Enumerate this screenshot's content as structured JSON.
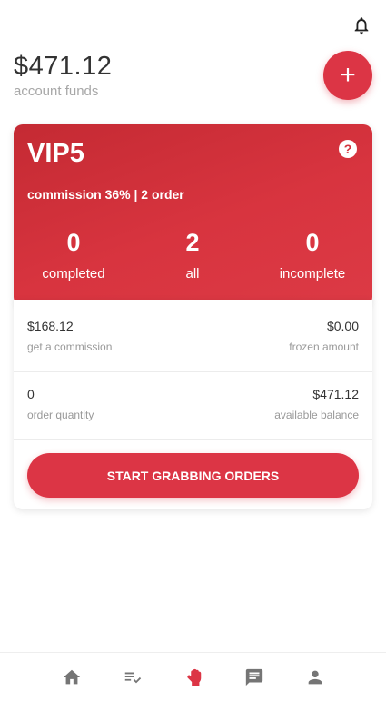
{
  "header": {
    "balance": "$471.12",
    "balance_label": "account funds",
    "add_label": "+"
  },
  "vip_card": {
    "level": "VIP5",
    "help_label": "?",
    "commission_text": "commission 36% | 2 order",
    "stats": [
      {
        "value": "0",
        "label": "completed"
      },
      {
        "value": "2",
        "label": "all"
      },
      {
        "value": "0",
        "label": "incomplete"
      }
    ]
  },
  "details": {
    "rows": [
      {
        "left": {
          "value": "$168.12",
          "label": "get a commission"
        },
        "right": {
          "value": "$0.00",
          "label": "frozen amount"
        }
      },
      {
        "left": {
          "value": "0",
          "label": "order quantity"
        },
        "right": {
          "value": "$471.12",
          "label": "available balance"
        }
      }
    ],
    "button_label": "START GRABBING ORDERS"
  },
  "colors": {
    "accent": "#dc3545",
    "card_gradient_start": "#c42a33",
    "muted_text": "#a7a7a7"
  },
  "tabbar": {
    "items": [
      {
        "icon": "home-icon"
      },
      {
        "icon": "playlist-check-icon"
      },
      {
        "icon": "grab-hand-icon",
        "active": true
      },
      {
        "icon": "message-icon"
      },
      {
        "icon": "person-icon"
      }
    ]
  }
}
